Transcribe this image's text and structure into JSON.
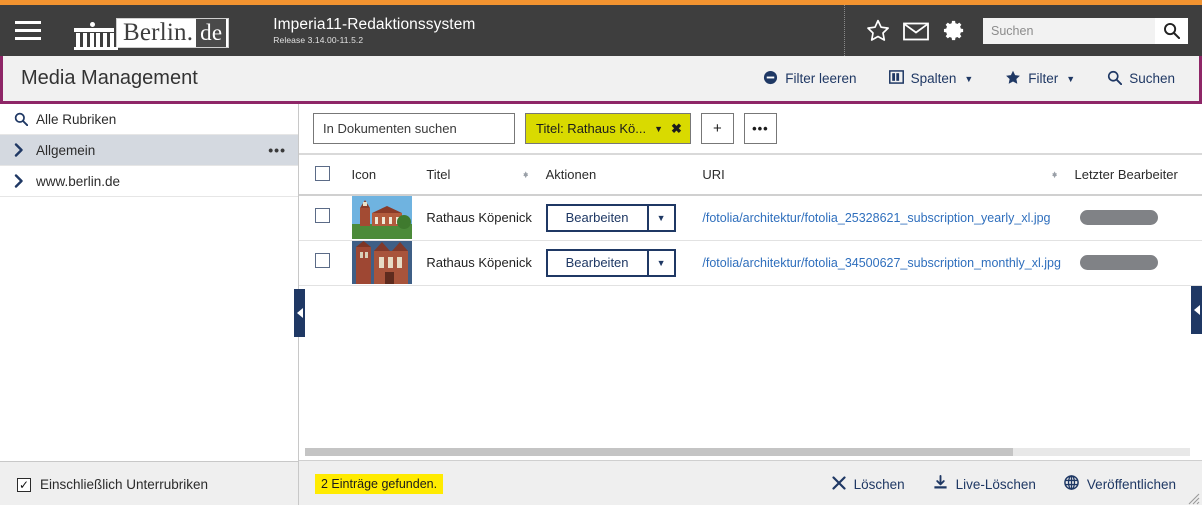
{
  "header": {
    "menu_icon": "hamburger-icon",
    "logo_text": "Berlin",
    "logo_dot": ".",
    "logo_de": "de",
    "app_title": "Imperia11-Redaktionssystem",
    "release": "Release 3.14.00-11.5.2",
    "icons": [
      "star-icon",
      "envelope-icon",
      "gear-icon"
    ],
    "search_placeholder": "Suchen",
    "search_value": "",
    "colors": {
      "top_stripe": "#f29330",
      "bar": "#3e3e3e"
    }
  },
  "titlebar": {
    "title": "Media Management",
    "border_color": "#8e2667",
    "actions": [
      {
        "label": "Filter leeren",
        "icon": "minus-circle-icon",
        "caret": false
      },
      {
        "label": "Spalten",
        "icon": "columns-icon",
        "caret": true,
        "caret_glyph": "▼"
      },
      {
        "label": "Filter",
        "icon": "star-filled-icon",
        "caret": true,
        "caret_glyph": "▼"
      },
      {
        "label": "Suchen",
        "icon": "search-icon",
        "caret": false
      }
    ]
  },
  "sidebar": {
    "items": [
      {
        "label": "Alle Rubriken",
        "icon": "search-icon",
        "active": false,
        "more": false
      },
      {
        "label": "Allgemein",
        "icon": "chevron-right-icon",
        "active": true,
        "more": true,
        "more_glyph": "•••"
      },
      {
        "label": "www.berlin.de",
        "icon": "chevron-right-icon",
        "active": false,
        "more": false
      }
    ],
    "footer": {
      "checkbox_label": "Einschließlich Unterrubriken",
      "checked": true,
      "check_glyph": "✓"
    }
  },
  "filterbar": {
    "search_placeholder": "In Dokumenten suchen",
    "search_value": "",
    "chip": {
      "label": "Titel: Rathaus Kö...",
      "caret_glyph": "▼",
      "close_glyph": "✖",
      "color": "#d9da00"
    },
    "add_button": "+",
    "more_button": "•••"
  },
  "table": {
    "columns": [
      {
        "key": "select",
        "label": "",
        "sortable": false
      },
      {
        "key": "icon",
        "label": "Icon",
        "sortable": false
      },
      {
        "key": "titel",
        "label": "Titel",
        "sortable": true
      },
      {
        "key": "aktionen",
        "label": "Aktionen",
        "sortable": false
      },
      {
        "key": "uri",
        "label": "URI",
        "sortable": true
      },
      {
        "key": "bearbeiter",
        "label": "Letzter Bearbeiter",
        "sortable": false
      }
    ],
    "rows": [
      {
        "selected": false,
        "thumb_alt": "rathaus-koepenick-exterior-daylight",
        "titel": "Rathaus Köpenick",
        "action_label": "Bearbeiten",
        "action_caret": "▼",
        "uri": "/fotolia/architektur/fotolia_25328621_subscription_yearly_xl.jpg",
        "bearbeiter": ""
      },
      {
        "selected": false,
        "thumb_alt": "rathaus-koepenick-facade-closeup",
        "titel": "Rathaus Köpenick",
        "action_label": "Bearbeiten",
        "action_caret": "▼",
        "uri": "/fotolia/architektur/fotolia_34500627_subscription_monthly_xl.jpg",
        "bearbeiter": ""
      }
    ]
  },
  "footer": {
    "count_text": "2 Einträge gefunden.",
    "count_highlight": "#ffeb00",
    "actions": [
      {
        "label": "Löschen",
        "icon": "x-icon"
      },
      {
        "label": "Live-Löschen",
        "icon": "download-icon"
      },
      {
        "label": "Veröffentlichen",
        "icon": "globe-icon"
      }
    ]
  },
  "handles": {
    "left": "collapse-left-handle",
    "right": "collapse-right-handle"
  }
}
